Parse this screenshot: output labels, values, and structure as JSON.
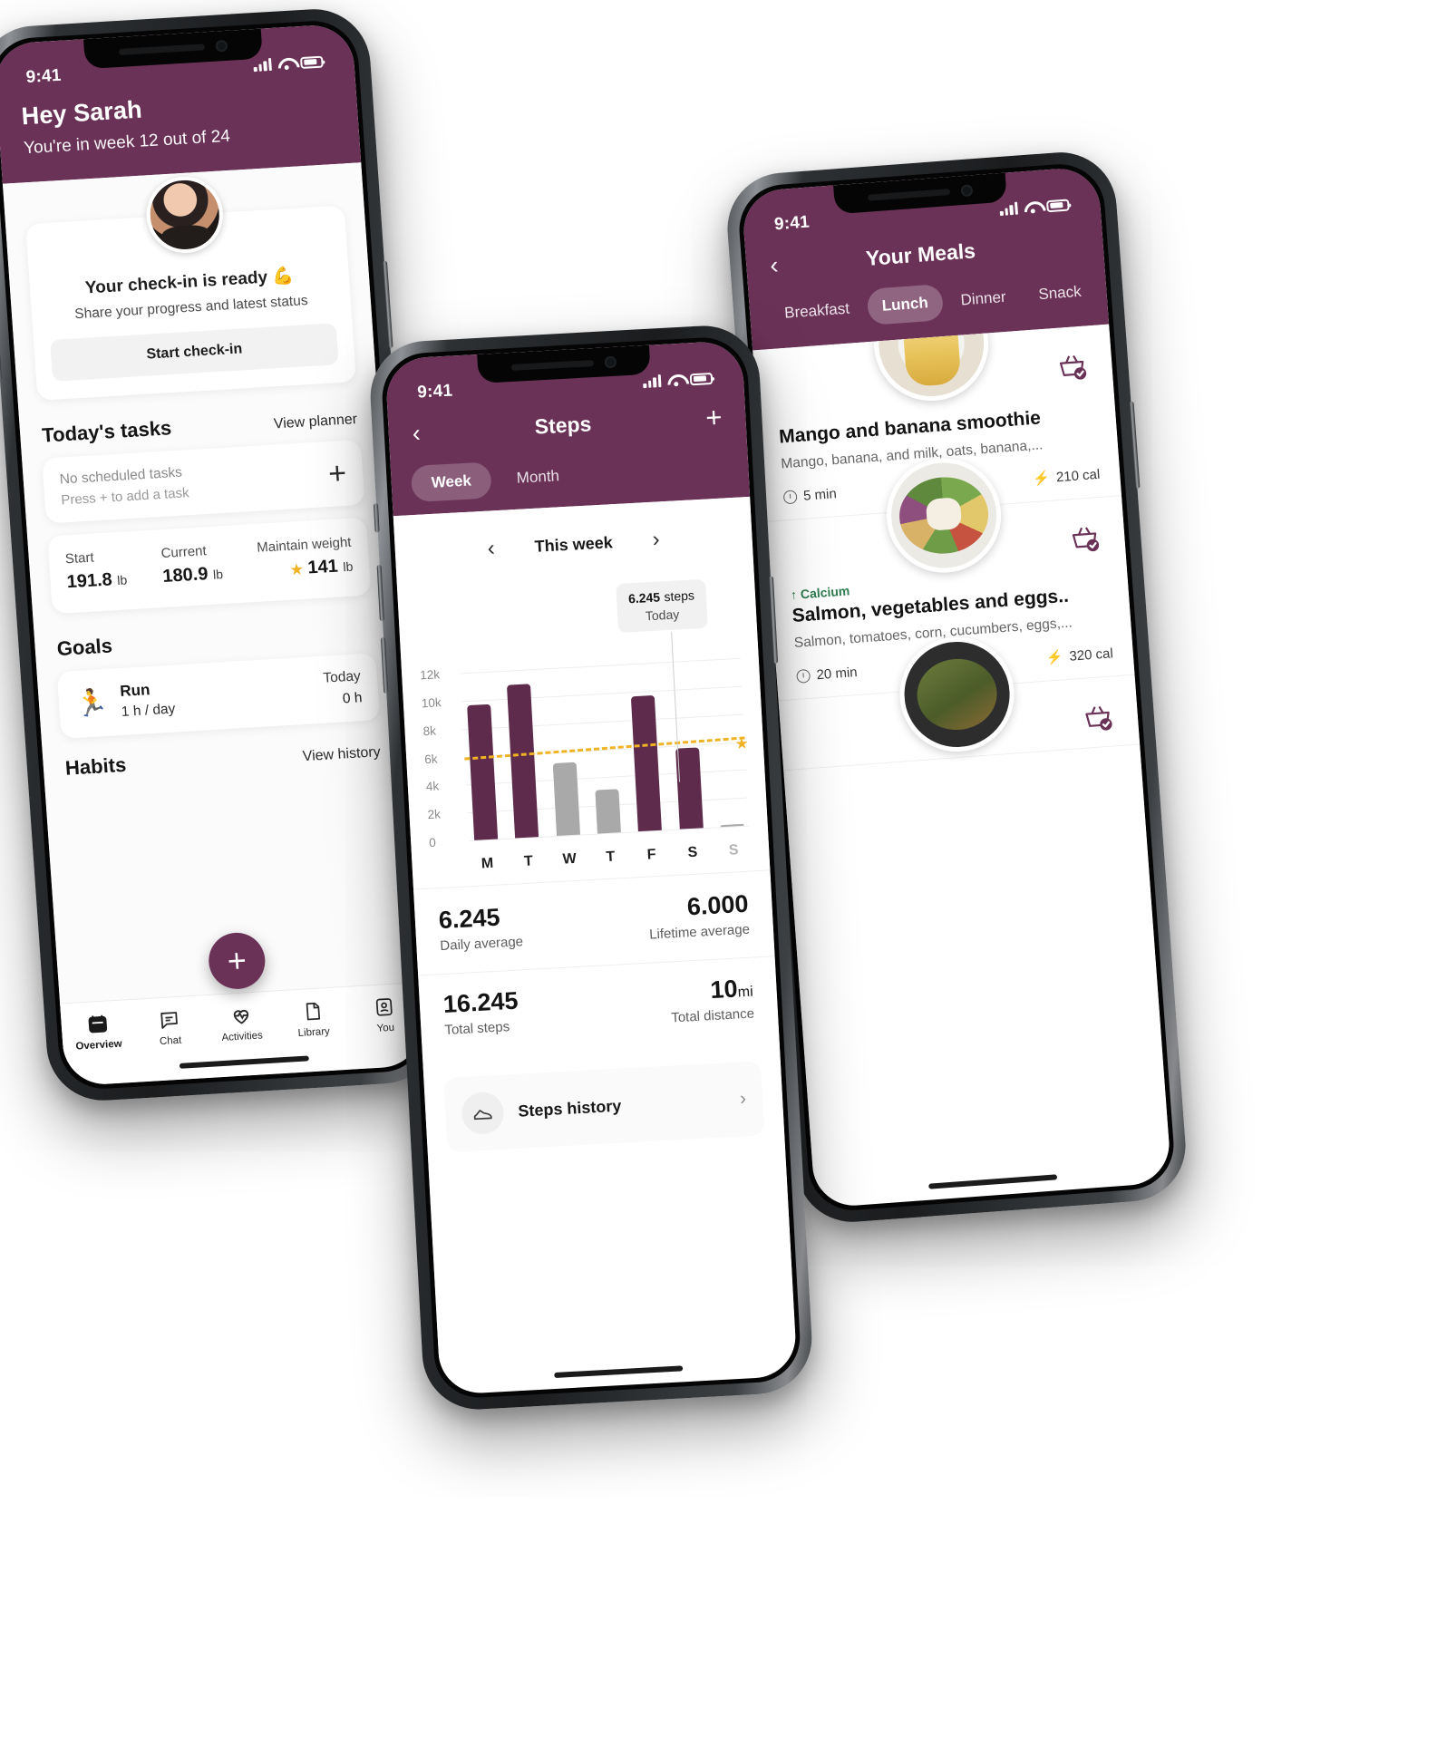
{
  "phones": {
    "overview": {
      "status": {
        "time": "9:41",
        "signal_icon": "cellular-bars-icon",
        "wifi_icon": "wifi-icon",
        "battery_icon": "battery-icon"
      },
      "header": {
        "greeting": "Hey Sarah",
        "subtitle": "You're in week 12 out of 24"
      },
      "checkin": {
        "avatar": "user-avatar",
        "title": "Your check-in is ready 💪",
        "description": "Share your progress and latest status",
        "button": "Start check-in"
      },
      "tasks": {
        "section_title": "Today's tasks",
        "link": "View planner",
        "empty_title": "No scheduled tasks",
        "empty_hint": "Press + to add a task",
        "add_icon": "plus-icon"
      },
      "weight": {
        "columns": [
          {
            "label": "Start",
            "value": "191.8",
            "unit": "lb",
            "star": false
          },
          {
            "label": "Current",
            "value": "180.9",
            "unit": "lb",
            "star": false
          },
          {
            "label": "Maintain weight",
            "value": "141",
            "unit": "lb",
            "star": true
          }
        ]
      },
      "goals": {
        "section_title": "Goals",
        "items": [
          {
            "emoji": "🏃",
            "name": "Run",
            "target": "1 h / day",
            "when": "Today",
            "progress": "0 h"
          }
        ]
      },
      "habits": {
        "section_title": "Habits",
        "link": "View history"
      },
      "fab": {
        "icon": "plus-icon",
        "label": "+"
      },
      "tabbar": [
        {
          "label": "Overview",
          "icon": "calendar-icon",
          "active": true
        },
        {
          "label": "Chat",
          "icon": "chat-bubble-icon",
          "active": false
        },
        {
          "label": "Activities",
          "icon": "heart-pulse-icon",
          "active": false
        },
        {
          "label": "Library",
          "icon": "book-icon",
          "active": false
        },
        {
          "label": "You",
          "icon": "person-icon",
          "active": false
        }
      ]
    },
    "steps": {
      "status": {
        "time": "9:41"
      },
      "header": {
        "back_icon": "chevron-left-icon",
        "title": "Steps",
        "add_icon": "plus-icon",
        "segments": [
          {
            "label": "Week",
            "active": true
          },
          {
            "label": "Month",
            "active": false
          }
        ]
      },
      "weeknav": {
        "prev_icon": "chevron-left-icon",
        "label": "This week",
        "next_icon": "chevron-right-icon"
      },
      "tooltip": {
        "value": "6.245",
        "unit": "steps",
        "day": "Today"
      },
      "stats": [
        {
          "value": "6.245",
          "label": "Daily average",
          "align": "left"
        },
        {
          "value": "6.000",
          "label": "Lifetime average",
          "align": "right"
        },
        {
          "value": "16.245",
          "label": "Total steps",
          "align": "left"
        },
        {
          "value": "10",
          "unit": "mi",
          "label": "Total distance",
          "align": "right"
        }
      ],
      "history": {
        "icon": "shoe-icon",
        "label": "Steps history",
        "chevron": "chevron-right-icon"
      }
    },
    "meals": {
      "status": {
        "time": "9:41"
      },
      "header": {
        "back_icon": "chevron-left-icon",
        "title": "Your Meals",
        "tabs": [
          {
            "label": "Breakfast",
            "active": false
          },
          {
            "label": "Lunch",
            "active": true
          },
          {
            "label": "Dinner",
            "active": false
          },
          {
            "label": "Snack",
            "active": false
          }
        ]
      },
      "cards": [
        {
          "name": "Mango and banana smoothie",
          "description": "Mango, banana, and milk, oats, banana,...",
          "time": "5 min",
          "calories": "210 cal",
          "tag": null,
          "basket_icon": "basket-check-icon",
          "image": "smoothie-photo"
        },
        {
          "name": "Salmon, vegetables and eggs..",
          "description": "Salmon, tomatoes, corn, cucumbers, eggs,...",
          "time": "20 min",
          "calories": "320 cal",
          "tag": "↑ Calcium",
          "basket_icon": "basket-check-icon",
          "image": "salad-bowl-photo"
        },
        {
          "name": "",
          "description": "",
          "time": "",
          "calories": "",
          "tag": null,
          "basket_icon": "basket-check-icon",
          "image": "noodle-bowl-photo"
        }
      ]
    }
  },
  "colors": {
    "brand_purple": "#6b3257",
    "accent_gold": "#f0b323",
    "bar_active": "#5e2b4c",
    "bar_inactive": "#a9a9a9",
    "green": "#2f7d4f"
  },
  "chart_data": {
    "type": "bar",
    "title": "Steps",
    "subtitle": "This week",
    "categories": [
      "M",
      "T",
      "W",
      "T",
      "F",
      "S",
      "S"
    ],
    "values": [
      9700,
      11000,
      5200,
      3100,
      9700,
      5800,
      150
    ],
    "bar_colors": [
      "#5e2b4c",
      "#5e2b4c",
      "#a9a9a9",
      "#a9a9a9",
      "#5e2b4c",
      "#5e2b4c",
      "#a9a9a9"
    ],
    "ytick_labels": [
      "12k",
      "10k",
      "8k",
      "6k",
      "4k",
      "2k",
      "0"
    ],
    "ytick_values": [
      12000,
      10000,
      8000,
      6000,
      4000,
      2000,
      0
    ],
    "ylim": [
      0,
      13000
    ],
    "grid": true,
    "average_line": {
      "label": "average",
      "value": 6000,
      "color": "#f0b323",
      "style": "dashed",
      "marker": "star"
    },
    "annotation": {
      "text": "6.245 steps",
      "sublabel": "Today",
      "at_category": "S"
    },
    "xlabel": "",
    "ylabel": ""
  }
}
